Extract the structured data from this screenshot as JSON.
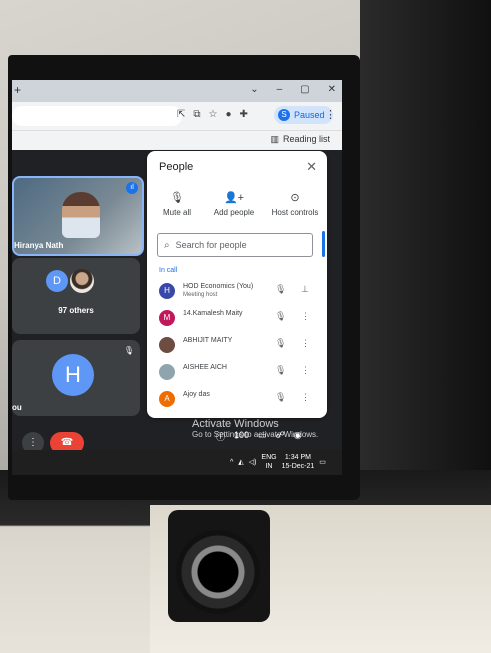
{
  "browser": {
    "new_tab_glyph": "+",
    "window_controls": [
      "⌄",
      "–",
      "▢",
      "✕"
    ],
    "toolbar_icons": [
      "⇱",
      "⧉",
      "☆",
      "●",
      "✚"
    ],
    "profile_initial": "S",
    "profile_label": "Paused",
    "menu_glyph": "⋮",
    "reading_list_label": "Reading list"
  },
  "meet": {
    "tile1_name": "Hiranya Nath",
    "tile2_avatar": "D",
    "tile2_label": "97 others",
    "tile3_avatar": "H",
    "tile3_label": "ou",
    "more_glyph": "⋮",
    "end_glyph": "☎",
    "activate_line1": "Activate Windows",
    "activate_line2": "Go to Settings to activate Windows.",
    "bottom_badge": "100"
  },
  "people_panel": {
    "title": "People",
    "close_glyph": "✕",
    "actions": [
      {
        "label": "Mute all",
        "icon": "mic-off-icon",
        "glyph": "🎙"
      },
      {
        "label": "Add people",
        "icon": "add-person-icon",
        "glyph": "👤+"
      },
      {
        "label": "Host controls",
        "icon": "toggle-icon",
        "glyph": "⊙"
      }
    ],
    "search_placeholder": "Search for people",
    "section_label": "In call",
    "participants": [
      {
        "initial": "H",
        "name": "HOD Economics (You)",
        "sub": "Meeting host",
        "color": "#3949ab"
      },
      {
        "initial": "M",
        "name": "14.Kamalesh Maity",
        "sub": "",
        "color": "#c2185b"
      },
      {
        "initial": "",
        "name": "ABHIJIT MAITY",
        "sub": "",
        "color": "#6d4c41"
      },
      {
        "initial": "",
        "name": "AISHEE AICH",
        "sub": "",
        "color": "#90a4ae"
      },
      {
        "initial": "A",
        "name": "Ajoy das",
        "sub": "",
        "color": "#ef6c00"
      }
    ]
  },
  "taskbar": {
    "lang_top": "ENG",
    "lang_bottom": "IN",
    "time": "1:34 PM",
    "date": "15-Dec-21"
  }
}
